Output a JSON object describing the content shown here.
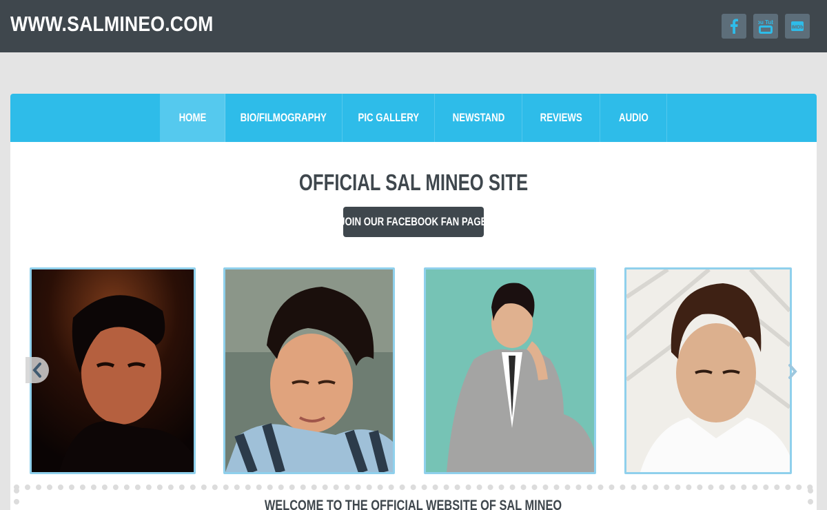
{
  "site": {
    "title": "WWW.SALMINEO.COM"
  },
  "social": [
    {
      "icon": "facebook-icon"
    },
    {
      "icon": "youtube-icon",
      "glyph_text": "You Tube"
    },
    {
      "icon": "imdb-icon",
      "glyph_text": "IMDb"
    }
  ],
  "nav": {
    "items": [
      {
        "label": "HOME",
        "active": true
      },
      {
        "label": "BIO/FILMOGRAPHY",
        "active": false
      },
      {
        "label": "PIC GALLERY",
        "active": false
      },
      {
        "label": "NEWSTAND",
        "active": false
      },
      {
        "label": "REVIEWS",
        "active": false
      },
      {
        "label": "AUDIO",
        "active": false
      }
    ]
  },
  "main": {
    "heading": "OFFICIAL SAL MINEO SITE",
    "fb_button": "JOIN OUR FACEBOOK FAN PAGE",
    "welcome": "WELCOME TO THE OFFICIAL WEBSITE OF SAL MINEO"
  },
  "carousel": {
    "photos": [
      "portrait-photo-1",
      "portrait-photo-2",
      "portrait-photo-3",
      "portrait-photo-4"
    ],
    "prev_icon": "chevron-left-icon",
    "next_icon": "chevron-right-icon"
  },
  "colors": {
    "topbar": "#3f474d",
    "nav": "#2ebce9",
    "nav_active": "#55c9ee",
    "photo_border": "#8fd0ec",
    "social_icon": "#2ebce9"
  }
}
